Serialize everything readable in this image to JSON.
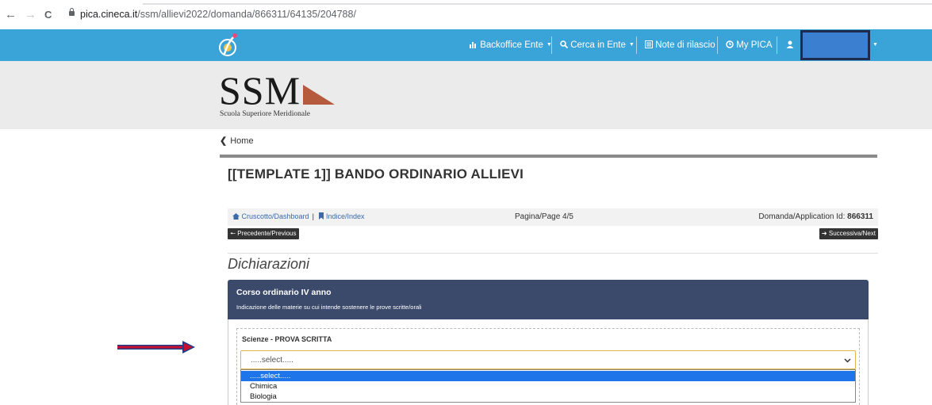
{
  "browser": {
    "back_icon": "←",
    "forward_icon": "→",
    "reload_icon": "C",
    "url_host": "pica.cineca.it",
    "url_path": "/ssm/allievi2022/domanda/866311/64135/204788/"
  },
  "topnav": {
    "items": [
      {
        "label": "Backoffice Ente",
        "icon": "bar-chart-icon"
      },
      {
        "label": "Cerca in Ente",
        "icon": "search-icon"
      },
      {
        "label": "Note di rilascio",
        "icon": "list-icon"
      },
      {
        "label": "My PICA",
        "icon": "clock-icon"
      }
    ]
  },
  "header": {
    "logo_text": "SSM",
    "logo_subtitle": "Scuola Superiore Meridionale"
  },
  "breadcrumb": {
    "home_label": "Home"
  },
  "page": {
    "title": "[[TEMPLATE 1]] BANDO ORDINARIO ALLIEVI"
  },
  "pager": {
    "dashboard_label": "Cruscotto/Dashboard",
    "separator": "|",
    "index_label": "Indice/Index",
    "page_label": "Pagina/Page 4/5",
    "application_label": "Domanda/Application Id:",
    "application_id": "866311",
    "prev_label": "Precedente/Previous",
    "next_label": "Successiva/Next"
  },
  "section": {
    "title": "Dichiarazioni"
  },
  "panel": {
    "title": "Corso ordinario IV anno",
    "subtitle": "Indicazione delle materie su cui intende sostenere le prove scritte/orali"
  },
  "field": {
    "label": "Scienze - PROVA SCRITTA",
    "value": ".....select.....",
    "options": [
      ".....select.....",
      "Chimica",
      "Biologia"
    ],
    "selected_index": 0
  },
  "colors": {
    "topbar": "#3aa3d8",
    "panel_header": "#3b4a6b",
    "option_highlight": "#1e74e9",
    "annotation_arrow": "#c8102e"
  }
}
